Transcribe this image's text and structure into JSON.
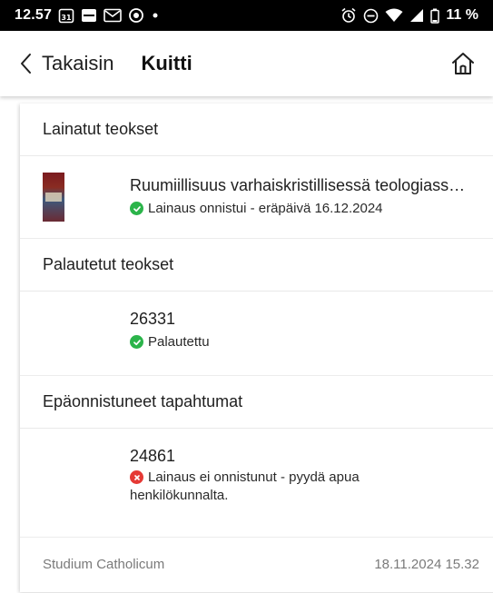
{
  "statusbar": {
    "time": "12.57",
    "calendar_day": "31",
    "battery": "11 %"
  },
  "appbar": {
    "back_label": "Takaisin",
    "title": "Kuitti"
  },
  "sections": {
    "borrowed": {
      "heading": "Lainatut teokset",
      "items": [
        {
          "title": "Ruumiillisuus varhaiskristillisessä teologiass…",
          "status": "Lainaus onnistui - eräpäivä 16.12.2024",
          "status_type": "success"
        }
      ]
    },
    "returned": {
      "heading": "Palautetut teokset",
      "items": [
        {
          "title": "26331",
          "status": "Palautettu",
          "status_type": "success"
        }
      ]
    },
    "failed": {
      "heading": "Epäonnistuneet tapahtumat",
      "items": [
        {
          "title": "24861",
          "status_line1": "Lainaus ei onnistunut - pyydä apua",
          "status_line2": "henkilökunnalta.",
          "status_type": "error"
        }
      ]
    }
  },
  "footer": {
    "library": "Studium Catholicum",
    "datetime": "18.11.2024 15.32"
  },
  "colors": {
    "success": "#2bb44a",
    "error": "#e53935"
  }
}
